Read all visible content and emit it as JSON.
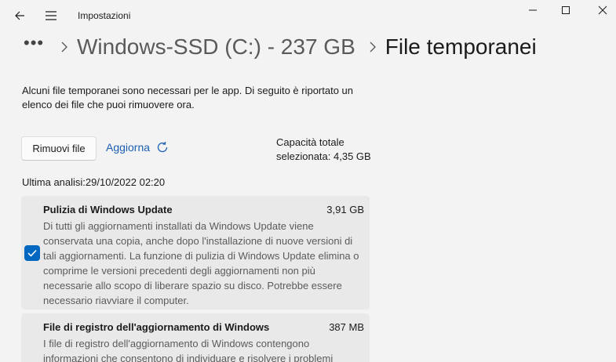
{
  "window": {
    "title": "Impostazioni",
    "controls": [
      "minimize-icon",
      "maximize-icon",
      "close-icon"
    ]
  },
  "breadcrumb": {
    "more": "•••",
    "items": [
      "Windows-SSD (C:) - 237 GB"
    ],
    "current": "File temporanei"
  },
  "description": "Alcuni file temporanei sono necessari per le app. Di seguito è riportato un elenco dei file che puoi rimuovere ora.",
  "actions": {
    "remove_label": "Rimuovi file",
    "refresh_label": "Aggiorna"
  },
  "capacity": {
    "line1": "Capacità totale",
    "line2": "selezionata: 4,35 GB"
  },
  "last_scan": "Ultima analisi:29/10/2022 02:20",
  "items": [
    {
      "title": "Pulizia di Windows Update",
      "size": "3,91 GB",
      "checked": true,
      "description": "Di tutti gli aggiornamenti installati da Windows Update viene conservata una copia, anche dopo l'installazione di nuove versioni di tali aggiornamenti. La funzione di pulizia di Windows Update elimina o comprime le versioni precedenti degli aggiornamenti non più necessarie allo scopo di liberare spazio su disco. Potrebbe essere necessario riavviare il computer."
    },
    {
      "title": "File di registro dell'aggiornamento di Windows",
      "size": "387 MB",
      "description": "I file di registro dell'aggiornamento di Windows contengono informazioni che consentono di individuare e risolvere i problemi"
    }
  ],
  "colors": {
    "accent": "#0067c0",
    "link": "#1a5fb4",
    "background": "#f3f3f3",
    "card": "#e9e9e9"
  }
}
